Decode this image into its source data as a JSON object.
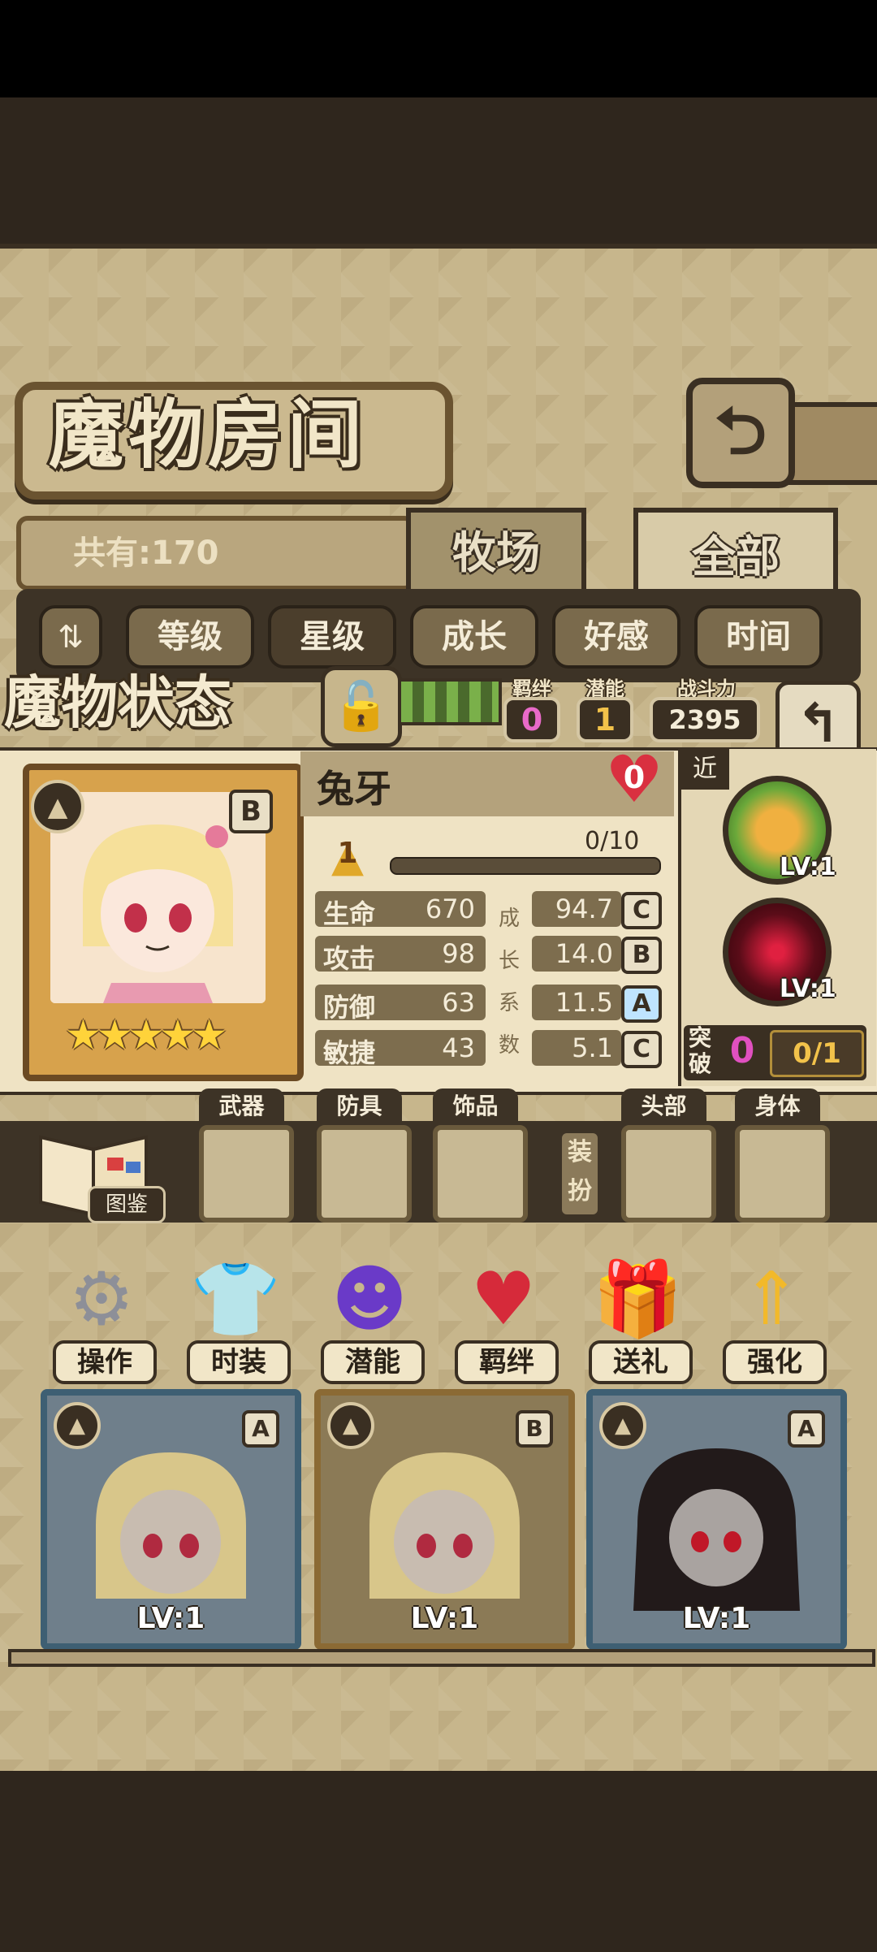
{
  "header": {
    "title": "魔物房间"
  },
  "summary": {
    "count": "共有:170"
  },
  "tabs": [
    "牧场",
    "全部"
  ],
  "filters": [
    "等级",
    "星级",
    "成长",
    "好感",
    "时间"
  ],
  "status": {
    "title": "魔物状态",
    "bond_label": "羁绊",
    "bond_value": "0",
    "potential_label": "潜能",
    "potential_value": "1",
    "power_label": "战斗力",
    "power_value": "2395"
  },
  "monster": {
    "name": "兔牙",
    "rank": "B",
    "affection": "0",
    "level": "1",
    "exp": "0/10",
    "exp_fraction": 0,
    "stars": 5,
    "stars_text": "★★★★★",
    "stats": [
      {
        "name": "生命",
        "value": "670",
        "coef": "94.7",
        "grade": "C"
      },
      {
        "name": "攻击",
        "value": "98",
        "coef": "14.0",
        "grade": "B"
      },
      {
        "name": "防御",
        "value": "63",
        "coef": "11.5",
        "grade": "A"
      },
      {
        "name": "敏捷",
        "value": "43",
        "coef": "5.1",
        "grade": "C"
      }
    ],
    "growth_label": [
      "成",
      "长",
      "系",
      "数"
    ]
  },
  "skills": {
    "range": "近",
    "list": [
      {
        "lv": "LV:1"
      },
      {
        "lv": "LV:1"
      }
    ],
    "break_label": "突破",
    "break_value": "0",
    "break_progress": "0/1"
  },
  "equipment": {
    "book_label": "图鉴",
    "slots": [
      "武器",
      "防具",
      "饰品",
      "头部",
      "身体"
    ],
    "dress_label": "装扮"
  },
  "actions": [
    "操作",
    "时装",
    "潜能",
    "羁绊",
    "送礼",
    "强化"
  ],
  "cards": [
    {
      "rank": "A",
      "lv": "LV:1"
    },
    {
      "rank": "B",
      "lv": "LV:1"
    },
    {
      "rank": "A",
      "lv": "LV:1"
    }
  ],
  "colors": {
    "panel": "#c7b68c",
    "dark": "#3a2f22",
    "heart": "#d93040"
  }
}
